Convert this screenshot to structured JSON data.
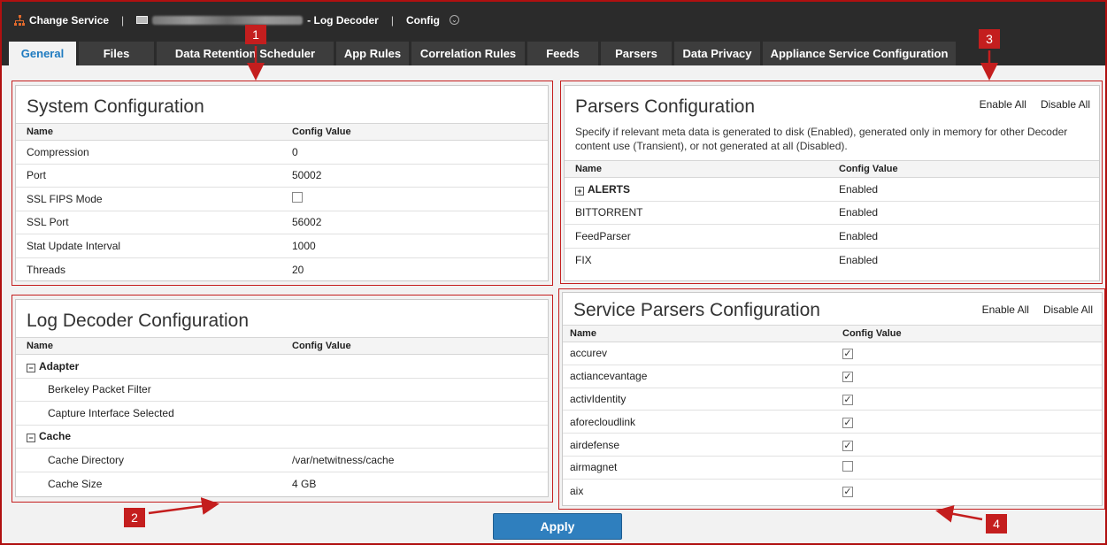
{
  "topbar": {
    "change_service": "Change Service",
    "service_name": "- Log Decoder",
    "view": "Config"
  },
  "tabs": [
    {
      "label": "General",
      "active": true
    },
    {
      "label": "Files"
    },
    {
      "label": "Data Retention Scheduler"
    },
    {
      "label": "App Rules"
    },
    {
      "label": "Correlation Rules"
    },
    {
      "label": "Feeds"
    },
    {
      "label": "Parsers"
    },
    {
      "label": "Data Privacy"
    },
    {
      "label": "Appliance Service Configuration"
    }
  ],
  "system_config": {
    "title": "System Configuration",
    "col_name": "Name",
    "col_value": "Config Value",
    "rows": [
      {
        "name": "Compression",
        "value": "0"
      },
      {
        "name": "Port",
        "value": "50002"
      },
      {
        "name": "SSL FIPS Mode",
        "checkbox": false
      },
      {
        "name": "SSL Port",
        "value": "56002"
      },
      {
        "name": "Stat Update Interval",
        "value": "1000"
      },
      {
        "name": "Threads",
        "value": "20"
      }
    ]
  },
  "log_decoder_config": {
    "title": "Log Decoder Configuration",
    "col_name": "Name",
    "col_value": "Config Value",
    "adapter": "Adapter",
    "berkeley": "Berkeley Packet Filter",
    "capture": "Capture Interface Selected",
    "cache": "Cache",
    "cache_dir": "Cache Directory",
    "cache_dir_value": "/var/netwitness/cache",
    "cache_size": "Cache Size",
    "cache_size_value": "4 GB"
  },
  "parsers_config": {
    "title": "Parsers Configuration",
    "enable_all": "Enable All",
    "disable_all": "Disable All",
    "description": "Specify if relevant meta data is generated to disk (Enabled), generated only in memory for other Decoder content use (Transient), or not generated at all (Disabled).",
    "col_name": "Name",
    "col_value": "Config Value",
    "rows": [
      {
        "name": "ALERTS",
        "value": "Enabled"
      },
      {
        "name": "BITTORRENT",
        "value": "Enabled"
      },
      {
        "name": "FeedParser",
        "value": "Enabled"
      },
      {
        "name": "FIX",
        "value": "Enabled"
      }
    ]
  },
  "service_parsers_config": {
    "title": "Service Parsers Configuration",
    "enable_all": "Enable All",
    "disable_all": "Disable All",
    "col_name": "Name",
    "col_value": "Config Value",
    "rows": [
      {
        "name": "accurev",
        "checked": true
      },
      {
        "name": "actiancevantage",
        "checked": true
      },
      {
        "name": "activIdentity",
        "checked": true
      },
      {
        "name": "aforecloudlink",
        "checked": true
      },
      {
        "name": "airdefense",
        "checked": true
      },
      {
        "name": "airmagnet",
        "checked": false
      },
      {
        "name": "aix",
        "checked": true
      }
    ]
  },
  "callouts": [
    "1",
    "2",
    "3",
    "4"
  ],
  "apply_label": "Apply",
  "colors": {
    "accent": "#1f7bc0",
    "callout": "#c41e1e",
    "topbar": "#2b2b2b"
  }
}
